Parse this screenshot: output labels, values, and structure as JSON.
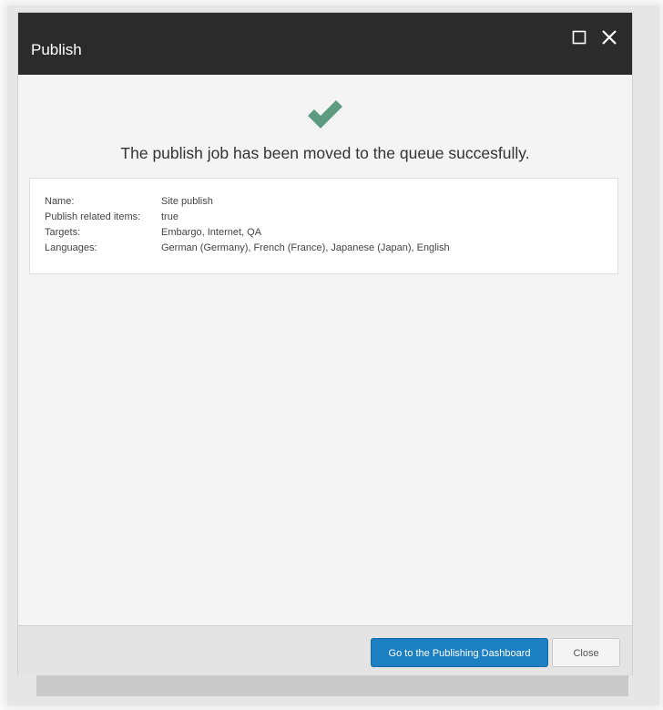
{
  "dialog": {
    "title": "Publish",
    "maximize_icon": "maximize-icon",
    "close_icon": "close-icon",
    "status_icon": "checkmark-icon",
    "status_color": "#5e9c82",
    "message": "The publish job has been moved to the queue succesfully."
  },
  "details": {
    "rows": [
      {
        "label": "Name:",
        "value": "Site publish"
      },
      {
        "label": "Publish related items:",
        "value": "true"
      },
      {
        "label": "Targets:",
        "value": "Embargo, Internet, QA"
      },
      {
        "label": "Languages:",
        "value": "German (Germany), French (France), Japanese (Japan), English"
      }
    ]
  },
  "footer": {
    "primary_label": "Go to the Publishing Dashboard",
    "primary_color": "#1c7fc2",
    "close_label": "Close"
  }
}
